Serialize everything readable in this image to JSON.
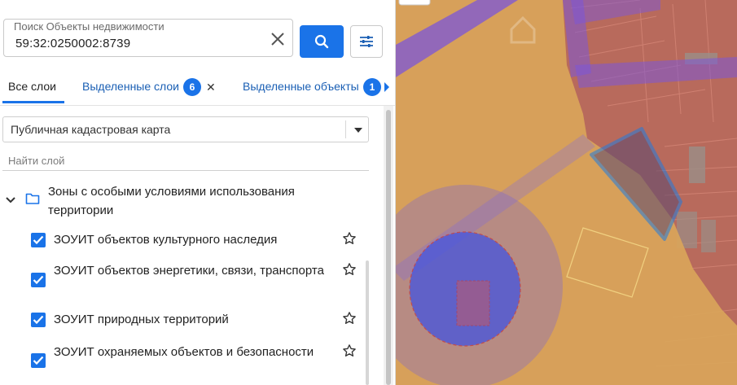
{
  "search": {
    "label": "Поиск Объекты недвижимости",
    "value": "59:32:0250002:8739"
  },
  "tabs": {
    "all_layers": "Все слои",
    "selected_layers": "Выделенные слои",
    "selected_layers_count": "6",
    "selected_objects": "Выделенные объекты",
    "selected_objects_count": "1"
  },
  "basemap": {
    "selected": "Публичная кадастровая карта"
  },
  "find_layer": {
    "placeholder": "Найти слой"
  },
  "layer_group": {
    "title": "Зоны с особыми условиями использования территории",
    "icon": "folder-icon",
    "expanded": true
  },
  "layers": [
    {
      "label": "ЗОУИТ объектов культурного наследия",
      "checked": true
    },
    {
      "label": "ЗОУИТ объектов энергетики, связи, транспорта",
      "checked": true
    },
    {
      "label": "ЗОУИТ природных территорий",
      "checked": true
    },
    {
      "label": "ЗОУИТ охраняемых объектов и безопасности",
      "checked": true
    }
  ],
  "colors": {
    "accent": "#1a73e8",
    "tab_link": "#1a5fb4",
    "zone_orange": "#e0a050",
    "zone_purple": "#7b4fd6",
    "zone_red": "#c85a4e",
    "parcel_outline": "#1e7be0"
  }
}
